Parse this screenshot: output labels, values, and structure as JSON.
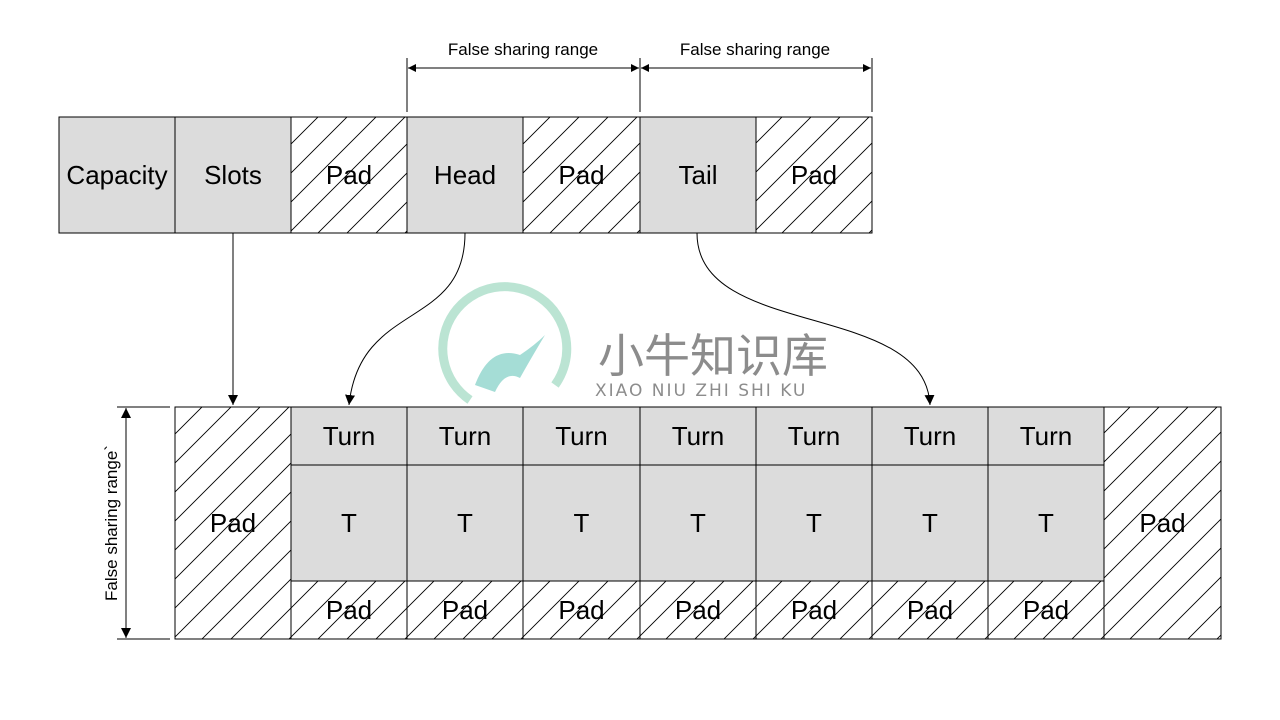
{
  "top_row": [
    "Capacity",
    "Slots",
    "Pad",
    "Head",
    "Pad",
    "Tail",
    "Pad"
  ],
  "top_row_hatched": [
    false,
    false,
    true,
    false,
    true,
    false,
    true
  ],
  "range_labels": [
    "False sharing range",
    "False sharing range"
  ],
  "vertical_range_label": "False sharing range`",
  "bottom": {
    "left_pad": "Pad",
    "right_pad": "Pad",
    "slots": [
      {
        "turn": "Turn",
        "value": "T",
        "pad": "Pad"
      },
      {
        "turn": "Turn",
        "value": "T",
        "pad": "Pad"
      },
      {
        "turn": "Turn",
        "value": "T",
        "pad": "Pad"
      },
      {
        "turn": "Turn",
        "value": "T",
        "pad": "Pad"
      },
      {
        "turn": "Turn",
        "value": "T",
        "pad": "Pad"
      },
      {
        "turn": "Turn",
        "value": "T",
        "pad": "Pad"
      },
      {
        "turn": "Turn",
        "value": "T",
        "pad": "Pad"
      }
    ]
  },
  "watermark": {
    "title": "小牛知识库",
    "subtitle": "XIAO NIU ZHI SHI KU"
  },
  "colors": {
    "cell_fill": "#dcdcdc",
    "stroke": "#000000",
    "watermark_text": "#8c8c8c",
    "watermark_logo": "#7fcfc4"
  }
}
